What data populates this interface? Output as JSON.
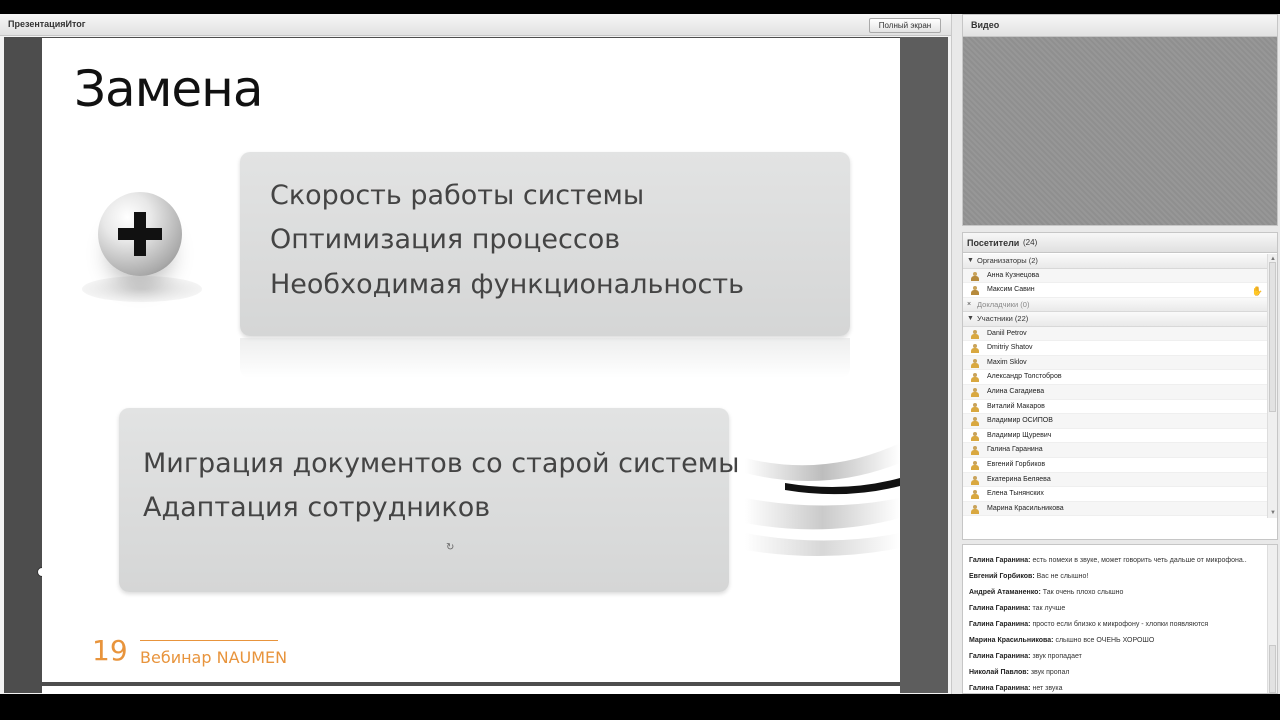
{
  "presentation": {
    "title": "ПрезентацияИтог",
    "fullscreen_label": "Полный экран"
  },
  "slide": {
    "title": "Замена",
    "panel1_lines": [
      "Скорость работы системы",
      "Оптимизация процессов",
      "Необходимая функциональность"
    ],
    "panel2_lines": [
      "Миграция документов со старой системы",
      "Адаптация сотрудников"
    ],
    "page_number": "19",
    "footer": "Вебинар NAUMEN"
  },
  "video": {
    "title": "Видео"
  },
  "attendees": {
    "title": "Посетители",
    "count": "(24)",
    "groups": {
      "organizers": "Организаторы (2)",
      "presenters": "Докладчики (0)",
      "participants": "Участники (22)"
    },
    "organizers": [
      "Анна Кузнецова",
      "Максим Савин"
    ],
    "participants": [
      "Daniil Petrov",
      "Dmitriy Shatov",
      "Maxim Sklov",
      "Александр Толстобров",
      "Алина Сагадиева",
      "Виталий Макаров",
      "Владимир ОСИПОВ",
      "Владимир Щуревич",
      "Галина Гаранина",
      "Евгений Горбиков",
      "Екатерина Беляева",
      "Елена Тынянских",
      "Марина Красильникова"
    ]
  },
  "chat": {
    "messages": [
      {
        "author": "Галина Гаранина:",
        "text": "есть помехи в звуке, может говорить четь дальше от микрофона.."
      },
      {
        "author": "Евгений Горбиков:",
        "text": "Вас не слышно!"
      },
      {
        "author": "Андрей Атаманенко:",
        "text": "Так очень плохо слышно"
      },
      {
        "author": "Галина Гаранина:",
        "text": "так лучше"
      },
      {
        "author": "Галина Гаранина:",
        "text": "просто если близко к микрофону - хлопки появляются"
      },
      {
        "author": "Марина Красильникова:",
        "text": "слышно все ОЧЕНЬ ХОРОШО"
      },
      {
        "author": "Галина Гаранина:",
        "text": "звук пропадает"
      },
      {
        "author": "Николай Павлов:",
        "text": "звук пропал"
      },
      {
        "author": "Галина Гаранина:",
        "text": "нет звука"
      }
    ]
  }
}
